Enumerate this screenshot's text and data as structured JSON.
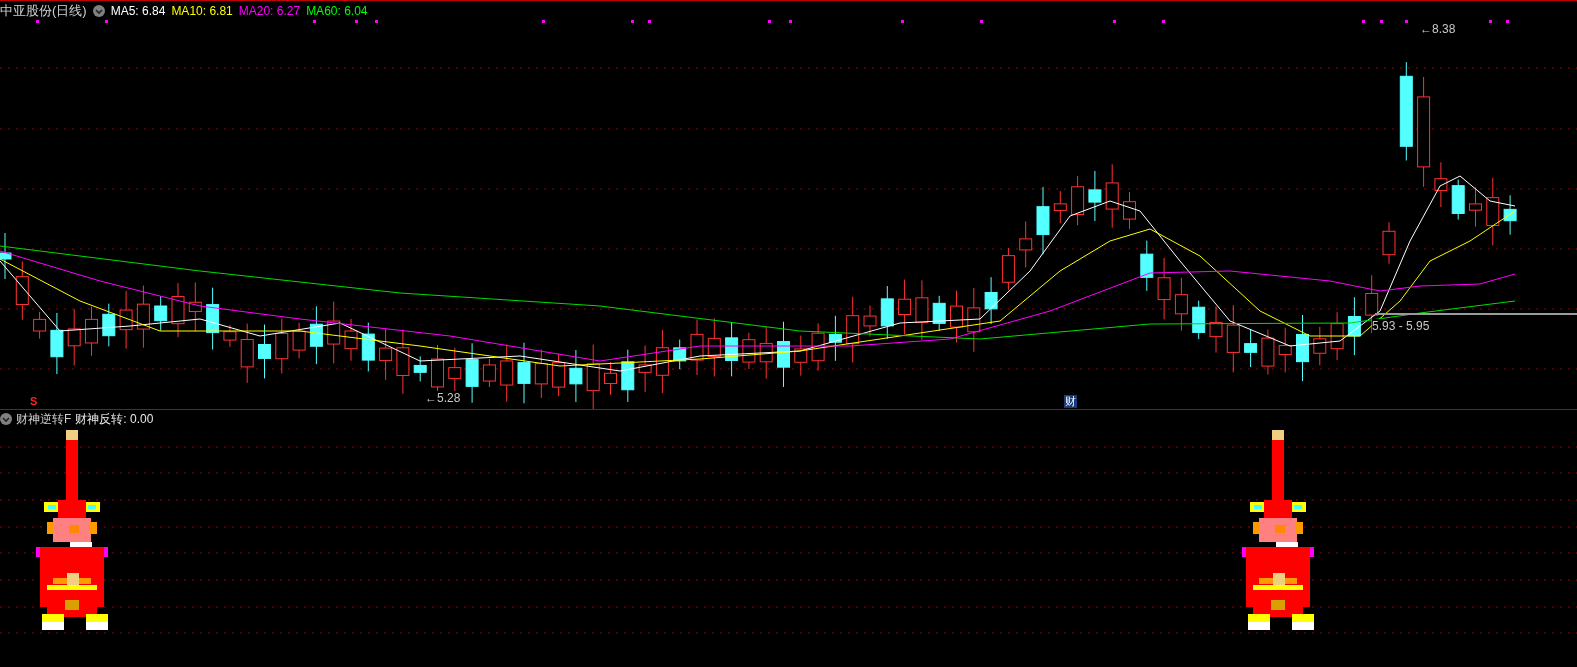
{
  "header": {
    "title": "中亚股份(日线)",
    "indicators": [
      {
        "label": "MA5: 6.84",
        "color": "#ffffff"
      },
      {
        "label": "MA10: 6.81",
        "color": "#ffff00"
      },
      {
        "label": "MA20: 6.27",
        "color": "#ff00ff"
      },
      {
        "label": "MA60: 6.04",
        "color": "#00ff00"
      }
    ]
  },
  "price_labels": [
    {
      "text": "←5.28"
    },
    {
      "text": "←8.38"
    },
    {
      "text": "5.93 - 5.95"
    }
  ],
  "signals": [
    {
      "text": "S",
      "kind": "sell"
    },
    {
      "text": "财",
      "kind": "buy"
    }
  ],
  "indicator_panel": {
    "name": "财神逆转F",
    "reading": "财神反转: 0.00"
  }
}
